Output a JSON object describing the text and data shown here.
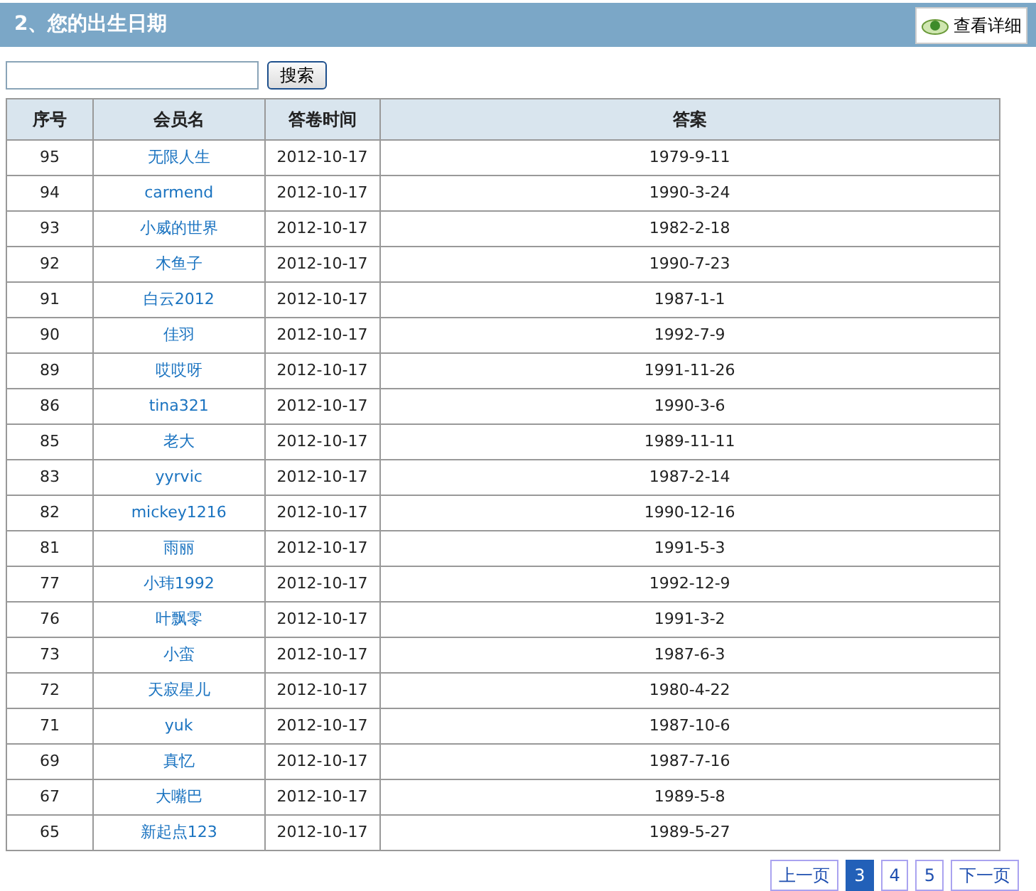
{
  "header": {
    "title": "2、您的出生日期",
    "detail_button": "查看详细"
  },
  "search": {
    "button": "搜索"
  },
  "table": {
    "columns": [
      "序号",
      "会员名",
      "答卷时间",
      "答案"
    ],
    "rows": [
      [
        "95",
        "无限人生",
        "2012-10-17",
        "1979-9-11"
      ],
      [
        "94",
        "carmend",
        "2012-10-17",
        "1990-3-24"
      ],
      [
        "93",
        "小威的世界",
        "2012-10-17",
        "1982-2-18"
      ],
      [
        "92",
        "木鱼子",
        "2012-10-17",
        "1990-7-23"
      ],
      [
        "91",
        "白云2012",
        "2012-10-17",
        "1987-1-1"
      ],
      [
        "90",
        "佳羽",
        "2012-10-17",
        "1992-7-9"
      ],
      [
        "89",
        "哎哎呀",
        "2012-10-17",
        "1991-11-26"
      ],
      [
        "86",
        "tina321",
        "2012-10-17",
        "1990-3-6"
      ],
      [
        "85",
        "老大",
        "2012-10-17",
        "1989-11-11"
      ],
      [
        "83",
        "yyrvic",
        "2012-10-17",
        "1987-2-14"
      ],
      [
        "82",
        "mickey1216",
        "2012-10-17",
        "1990-12-16"
      ],
      [
        "81",
        "雨丽",
        "2012-10-17",
        "1991-5-3"
      ],
      [
        "77",
        "小玮1992",
        "2012-10-17",
        "1992-12-9"
      ],
      [
        "76",
        "叶飘零",
        "2012-10-17",
        "1991-3-2"
      ],
      [
        "73",
        "小蛮",
        "2012-10-17",
        "1987-6-3"
      ],
      [
        "72",
        "天寂星儿",
        "2012-10-17",
        "1980-4-22"
      ],
      [
        "71",
        "yuk",
        "2012-10-17",
        "1987-10-6"
      ],
      [
        "69",
        "真忆",
        "2012-10-17",
        "1987-7-16"
      ],
      [
        "67",
        "大嘴巴",
        "2012-10-17",
        "1989-5-8"
      ],
      [
        "65",
        "新起点123",
        "2012-10-17",
        "1989-5-27"
      ]
    ]
  },
  "pagination": [
    {
      "label": "上一页",
      "selected": false
    },
    {
      "label": "3",
      "selected": true
    },
    {
      "label": "4",
      "selected": false
    },
    {
      "label": "5",
      "selected": false
    },
    {
      "label": "下一页",
      "selected": false
    }
  ]
}
